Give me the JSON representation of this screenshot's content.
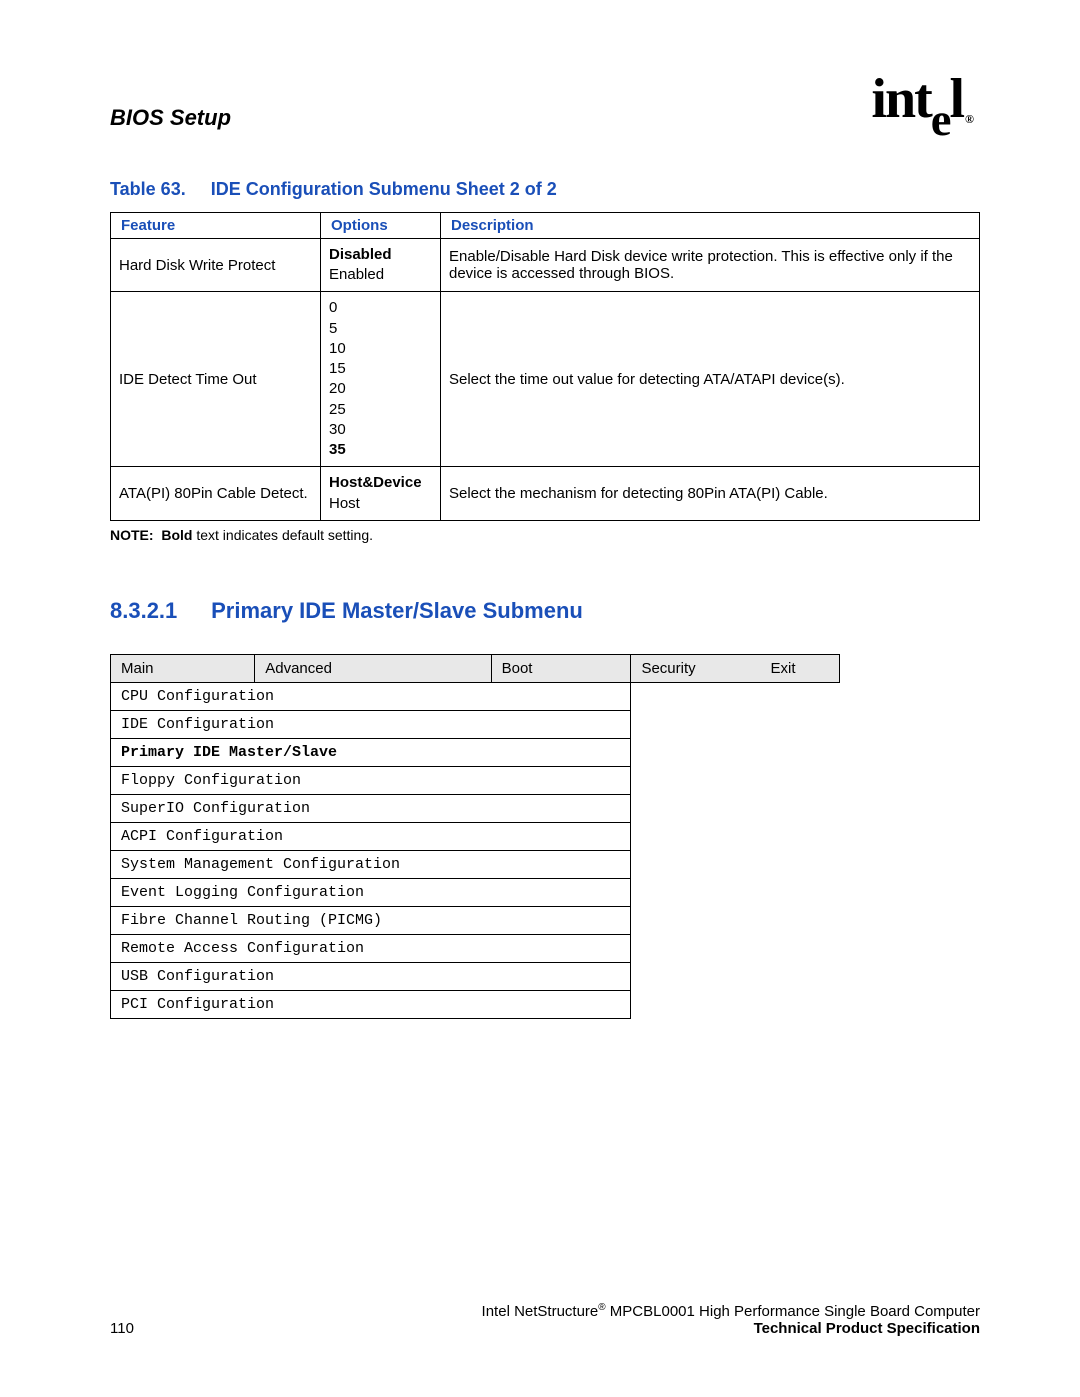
{
  "header": {
    "title": "BIOS Setup",
    "logo_text": "intel",
    "logo_reg": "®"
  },
  "table63": {
    "caption_label": "Table 63.",
    "caption_title": "IDE Configuration Submenu Sheet 2 of 2",
    "headers": {
      "feature": "Feature",
      "options": "Options",
      "description": "Description"
    },
    "rows": [
      {
        "feature": "Hard Disk Write Protect",
        "options": [
          {
            "text": "Disabled",
            "bold": true
          },
          {
            "text": "Enabled",
            "bold": false
          }
        ],
        "description": "Enable/Disable Hard Disk device write protection. This is effective only if the device is accessed through BIOS."
      },
      {
        "feature": "IDE Detect Time Out",
        "options": [
          {
            "text": "0",
            "bold": false
          },
          {
            "text": "5",
            "bold": false
          },
          {
            "text": "10",
            "bold": false
          },
          {
            "text": "15",
            "bold": false
          },
          {
            "text": "20",
            "bold": false
          },
          {
            "text": "25",
            "bold": false
          },
          {
            "text": "30",
            "bold": false
          },
          {
            "text": "35",
            "bold": true
          }
        ],
        "description": "Select the time out value for detecting ATA/ATAPI device(s)."
      },
      {
        "feature": "ATA(PI) 80Pin Cable Detect.",
        "options": [
          {
            "text": "Host&Device",
            "bold": true
          },
          {
            "text": "Host",
            "bold": false
          }
        ],
        "description": "Select the mechanism for detecting 80Pin ATA(PI) Cable."
      }
    ],
    "note_label": "NOTE:",
    "note_bold_word": "Bold",
    "note_rest": " text indicates default setting."
  },
  "section": {
    "number": "8.3.2.1",
    "title": "Primary IDE Master/Slave Submenu"
  },
  "menu": {
    "tabs": [
      "Main",
      "Advanced",
      "Boot",
      "Security",
      "Exit"
    ],
    "items": [
      {
        "label": "CPU Configuration",
        "selected": false
      },
      {
        "label": "IDE Configuration",
        "selected": false
      },
      {
        "label": "Primary IDE Master/Slave",
        "selected": true
      },
      {
        "label": "Floppy Configuration",
        "selected": false
      },
      {
        "label": "SuperIO Configuration",
        "selected": false
      },
      {
        "label": "ACPI Configuration",
        "selected": false
      },
      {
        "label": "System Management Configuration",
        "selected": false
      },
      {
        "label": "Event Logging Configuration",
        "selected": false
      },
      {
        "label": "Fibre Channel Routing (PICMG)",
        "selected": false
      },
      {
        "label": "Remote Access Configuration",
        "selected": false
      },
      {
        "label": "USB Configuration",
        "selected": false
      },
      {
        "label": "PCI Configuration",
        "selected": false
      }
    ]
  },
  "footer": {
    "page_number": "110",
    "line1_pre": "Intel NetStructure",
    "line1_sup": "®",
    "line1_post": " MPCBL0001 High Performance Single Board Computer",
    "line2": "Technical Product Specification"
  }
}
